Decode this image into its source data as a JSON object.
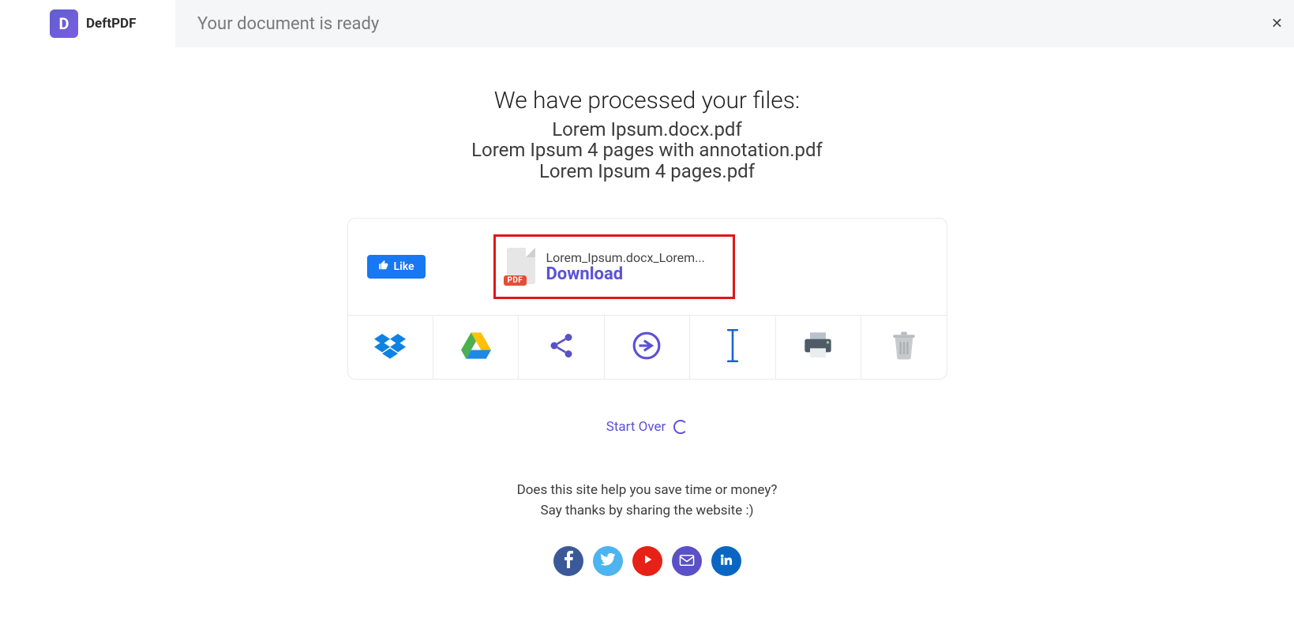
{
  "brand": {
    "logo_letter": "D",
    "name": "DeftPDF"
  },
  "header": {
    "ready_text": "Your document is ready"
  },
  "processed": {
    "title": "We have processed your files:",
    "files": [
      "Lorem Ipsum.docx.pdf",
      "Lorem Ipsum 4 pages with annotation.pdf",
      "Lorem Ipsum 4 pages.pdf"
    ]
  },
  "like": {
    "label": "Like"
  },
  "download": {
    "filename": "Lorem_Ipsum.docx_Lorem...",
    "label": "Download",
    "badge": "PDF"
  },
  "action_icons": {
    "dropbox": "dropbox-icon",
    "drive": "google-drive-icon",
    "share": "share-icon",
    "continue": "arrow-right-circle-icon",
    "rename": "text-cursor-icon",
    "print": "printer-icon",
    "delete": "trash-icon"
  },
  "startover": {
    "label": "Start Over"
  },
  "help": {
    "line1": "Does this site help you save time or money?",
    "line2": "Say thanks by sharing the website :)"
  },
  "social_icons": {
    "facebook": "facebook-icon",
    "twitter": "twitter-icon",
    "youtube": "youtube-icon",
    "email": "email-icon",
    "linkedin": "linkedin-icon"
  }
}
